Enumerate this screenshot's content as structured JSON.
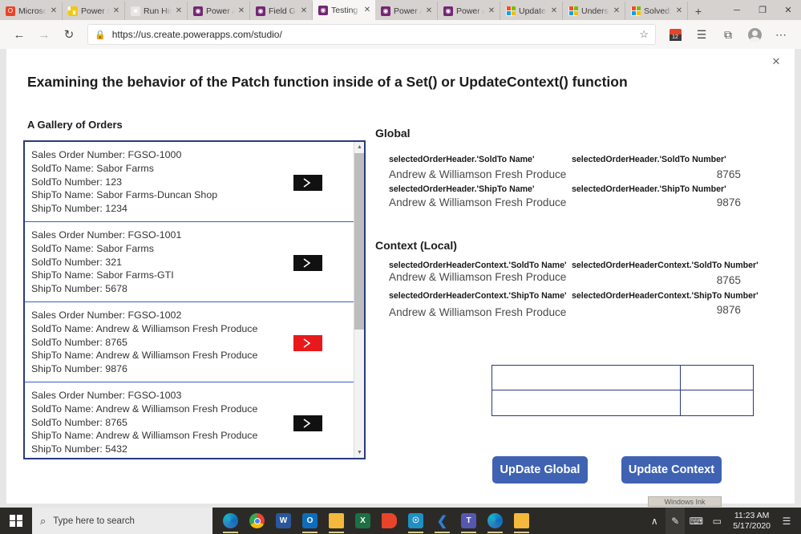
{
  "browser": {
    "tabs": [
      {
        "label": "Microsoft",
        "favicon": "office-icon",
        "active": false
      },
      {
        "label": "Power BI",
        "favicon": "powerbi-icon",
        "active": false
      },
      {
        "label": "Run Histo",
        "favicon": "runhistory-icon",
        "active": false
      },
      {
        "label": "Power Ap",
        "favicon": "powerapps-icon",
        "active": false
      },
      {
        "label": "Field Gen",
        "favicon": "powerapps-icon",
        "active": false
      },
      {
        "label": "Testing G",
        "favicon": "powerapps-icon",
        "active": true
      },
      {
        "label": "Power Ap",
        "favicon": "powerapps-icon",
        "active": false
      },
      {
        "label": "Power Ap",
        "favicon": "powerapps-icon",
        "active": false
      },
      {
        "label": "UpdateCo",
        "favicon": "microsoft-icon",
        "active": false
      },
      {
        "label": "Understa",
        "favicon": "microsoft-icon",
        "active": false
      },
      {
        "label": "Solved: R",
        "favicon": "microsoft-icon",
        "active": false
      }
    ],
    "new_tab_label": "+",
    "window_controls": {
      "minimize": "─",
      "maximize": "❐",
      "close": "✕"
    },
    "nav": {
      "back": "←",
      "forward": "→",
      "refresh": "↻"
    },
    "url": "https://us.create.powerapps.com/studio/",
    "lock_glyph": "⌂",
    "star_glyph": "☆",
    "calendar_badge": "12",
    "favorites_glyph": "☰",
    "collections_glyph": "⧉",
    "more_glyph": "⋯"
  },
  "modal": {
    "close_label": "✕",
    "title": "Examining the behavior of the Patch function inside of a Set() or UpdateContext() function"
  },
  "gallery": {
    "label": "A Gallery of Orders",
    "scroll_up": "▲",
    "scroll_down": "▼",
    "field_labels": {
      "sales_order": "Sales Order Number:",
      "soldto_name": "SoldTo Name:",
      "soldto_number": "SoldTo Number:",
      "shipto_name": "ShipTo Name:",
      "shipto_number": "ShipTo Number:"
    },
    "items": [
      {
        "sales_order_number": "FGSO-1000",
        "soldto_name": "Sabor Farms",
        "soldto_number": "123",
        "shipto_name": "Sabor Farms-Duncan Shop",
        "shipto_number": "1234",
        "selected": false,
        "arrow_color": "#111111"
      },
      {
        "sales_order_number": "FGSO-1001",
        "soldto_name": "Sabor Farms",
        "soldto_number": "321",
        "shipto_name": "Sabor Farms-GTI",
        "shipto_number": "5678",
        "selected": false,
        "arrow_color": "#111111"
      },
      {
        "sales_order_number": "FGSO-1002",
        "soldto_name": "Andrew & Williamson Fresh Produce",
        "soldto_number": "8765",
        "shipto_name": "Andrew & Williamson Fresh Produce",
        "shipto_number": "9876",
        "selected": true,
        "arrow_color": "#e8191a"
      },
      {
        "sales_order_number": "FGSO-1003",
        "soldto_name": "Andrew & Williamson Fresh Produce",
        "soldto_number": "8765",
        "shipto_name": "Andrew & Williamson Fresh Produce",
        "shipto_number": "5432",
        "selected": false,
        "arrow_color": "#111111"
      }
    ]
  },
  "global": {
    "heading": "Global",
    "soldto_name_label": "selectedOrderHeader.'SoldTo Name'",
    "soldto_name_value": "Andrew & Williamson Fresh Produce",
    "soldto_number_label": "selectedOrderHeader.'SoldTo Number'",
    "soldto_number_value": "8765",
    "shipto_name_label": "selectedOrderHeader.'ShipTo Name'",
    "shipto_name_value": "Andrew & Williamson Fresh Produce",
    "shipto_number_label": "selectedOrderHeader.'ShipTo Number'",
    "shipto_number_value": "9876"
  },
  "context": {
    "heading": "Context (Local)",
    "soldto_name_label": "selectedOrderHeaderContext.'SoldTo Name'",
    "soldto_name_value": "Andrew & Williamson Fresh Produce",
    "soldto_number_label": "selectedOrderHeaderContext.'SoldTo Number'",
    "soldto_number_value": "8765",
    "shipto_name_label": "selectedOrderHeaderContext.'ShipTo Name'",
    "shipto_name_value": "Andrew & Williamson Fresh Produce",
    "shipto_number_label": "selectedOrderHeaderContext.'ShipTo Number'",
    "shipto_number_value": "9876"
  },
  "empty_table": {
    "rows": [
      {
        "left": "",
        "right": ""
      },
      {
        "left": "",
        "right": ""
      }
    ]
  },
  "buttons": {
    "update_global": "UpDate Global",
    "update_context": "Update Context",
    "accent_color": "#3f62b3"
  },
  "taskbar": {
    "search_placeholder": "Type here to search",
    "search_icon": "⌕",
    "ink_tooltip": "Windows Ink Workspace",
    "time": "11:23 AM",
    "date": "5/17/2020",
    "tray": {
      "chevron": "∧",
      "pen": "✎",
      "keyboard": "⌨",
      "touchpad": "▭",
      "notifications": "☰"
    },
    "apps": [
      {
        "name": "edge-legacy-icon",
        "running": true
      },
      {
        "name": "chrome-icon",
        "running": false
      },
      {
        "name": "word-icon",
        "running": false,
        "letter": "W",
        "color": "#2b579a"
      },
      {
        "name": "outlook-icon",
        "running": true,
        "letter": "O",
        "color": "#0f6cbd"
      },
      {
        "name": "file-explorer-icon",
        "running": true,
        "letter": "",
        "color": "#f3b83c"
      },
      {
        "name": "excel-icon",
        "running": false,
        "letter": "X",
        "color": "#1d7044"
      },
      {
        "name": "office-icon",
        "running": false,
        "letter": "",
        "color": "#e8442a"
      },
      {
        "name": "teams-web-icon",
        "running": true,
        "letter": "",
        "color": "#1f8fc4"
      },
      {
        "name": "vscode-icon",
        "running": true,
        "letter": "",
        "color": "#1f7fc4"
      },
      {
        "name": "teams-icon",
        "running": true,
        "letter": "",
        "color": "#5558af"
      },
      {
        "name": "edge-icon",
        "running": true,
        "letter": "",
        "color": "#1f8fc4"
      },
      {
        "name": "snip-sketch-icon",
        "running": true,
        "letter": "",
        "color": "#f3b83c"
      }
    ]
  }
}
